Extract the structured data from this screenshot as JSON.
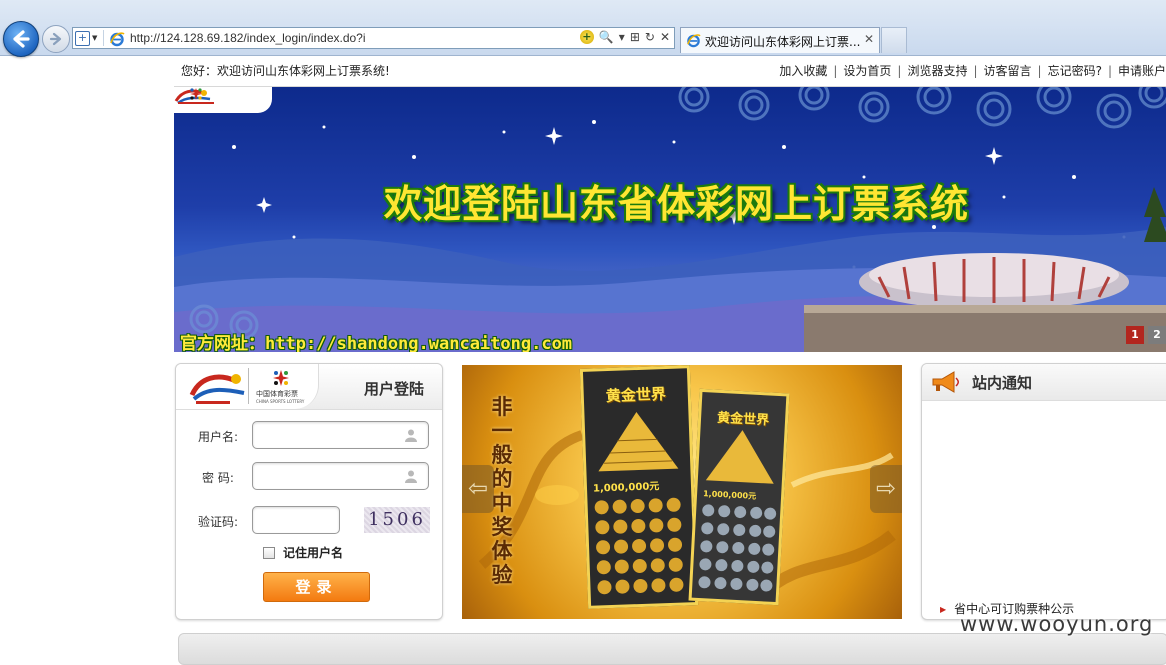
{
  "browser": {
    "url": "http://124.128.69.182/index_login/index.do?i",
    "tab_title": "欢迎访问山东体彩网上订票...",
    "tab_close": "✕",
    "addr_tools": [
      "🔍",
      "▾",
      "⊞",
      "↻",
      "✕"
    ]
  },
  "topbar": {
    "welcome": "您好：欢迎访问山东体彩网上订票系统!",
    "links": [
      "加入收藏",
      "设为首页",
      "浏览器支持",
      "访客留言",
      "忘记密码?",
      "申请账户"
    ],
    "separator": "|"
  },
  "banner": {
    "title": "欢迎登陆山东省体彩网上订票系统",
    "url_line": "官方网址：http://shandong.wancaitong.com",
    "slides": [
      "1",
      "2"
    ]
  },
  "logo": {
    "cn": "中国体育彩票",
    "en": "CHINA SPORTS LOTTERY"
  },
  "login": {
    "title": "用户登陆",
    "username_label": "用户名:",
    "password_label": "密  码:",
    "captcha_label": "验证码:",
    "captcha_value": "1506",
    "remember_label": "记住用户名",
    "submit_label": "登录"
  },
  "promo": {
    "slogan": "非一般的中奖体验",
    "ticket_title": "黄金世界",
    "prize_text": "1,000,000元",
    "arrow_left": "⇦",
    "arrow_right": "⇨"
  },
  "notice": {
    "title": "站内通知",
    "items": [
      "省中心可订购票种公示"
    ]
  },
  "watermark": "www.wooyun.org",
  "colors": {
    "accent_orange": "#f37a10",
    "banner_blue": "#1e3ea9",
    "title_yellow": "#ffe632",
    "slide_active": "#b3261e"
  }
}
